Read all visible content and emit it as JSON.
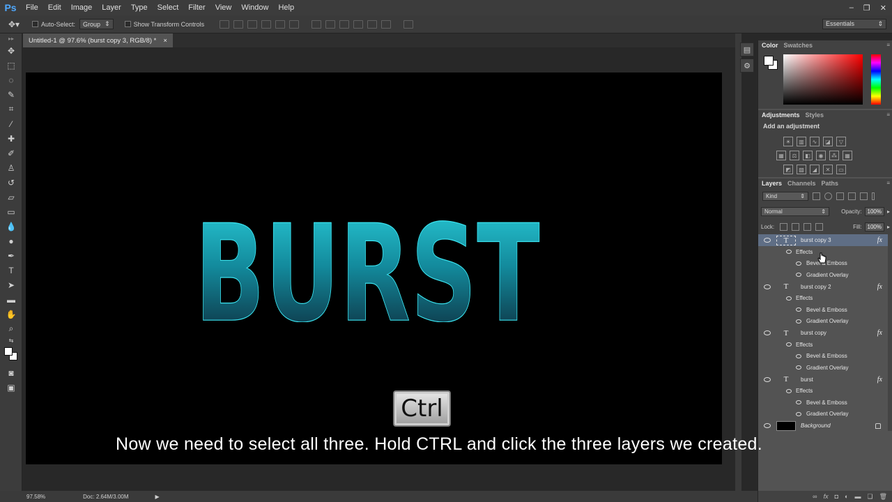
{
  "app": {
    "logo": "Ps"
  },
  "menu": [
    "File",
    "Edit",
    "Image",
    "Layer",
    "Type",
    "Select",
    "Filter",
    "View",
    "Window",
    "Help"
  ],
  "window_controls": [
    "–",
    "❐",
    "✕"
  ],
  "options": {
    "auto_select_label": "Auto-Select:",
    "auto_select_value": "Group",
    "show_transform_label": "Show Transform Controls",
    "workspace": "Essentials"
  },
  "document": {
    "tab_title": "Untitled-1 @ 97.6% (burst copy 3, RGB/8) *",
    "close_glyph": "×",
    "canvas_text": "BURST"
  },
  "status": {
    "zoom": "97.58%",
    "doc_info": "Doc: 2.64M/3.00M"
  },
  "color_panel": {
    "tabs": [
      "Color",
      "Swatches"
    ]
  },
  "adjustments_panel": {
    "tabs": [
      "Adjustments",
      "Styles"
    ],
    "label": "Add an adjustment"
  },
  "layers_panel": {
    "tabs": [
      "Layers",
      "Channels",
      "Paths"
    ],
    "filter_kind": "Kind",
    "blend_mode": "Normal",
    "opacity_label": "Opacity:",
    "opacity_value": "100%",
    "lock_label": "Lock:",
    "fill_label": "Fill:",
    "fill_value": "100%",
    "layers": [
      {
        "name": "burst copy 3",
        "effects_label": "Effects",
        "effects": [
          "Bevel & Emboss",
          "Gradient Overlay"
        ],
        "selected": true
      },
      {
        "name": "burst copy 2",
        "effects_label": "Effects",
        "effects": [
          "Bevel & Emboss",
          "Gradient Overlay"
        ],
        "selected": false
      },
      {
        "name": "burst copy",
        "effects_label": "Effects",
        "effects": [
          "Bevel & Emboss",
          "Gradient Overlay"
        ],
        "selected": false
      },
      {
        "name": "burst",
        "effects_label": "Effects",
        "effects": [
          "Bevel & Emboss",
          "Gradient Overlay"
        ],
        "selected": false
      }
    ],
    "background_name": "Background",
    "fx_glyph": "fx"
  },
  "overlay": {
    "key": "Ctrl",
    "caption": "Now we need to select all three. Hold CTRL and click the three layers we created."
  },
  "colors": {
    "accent_selection": "#5f6e85",
    "text_gradient_top": "#2ad0dc",
    "text_gradient_bottom": "#0c1e2e"
  }
}
